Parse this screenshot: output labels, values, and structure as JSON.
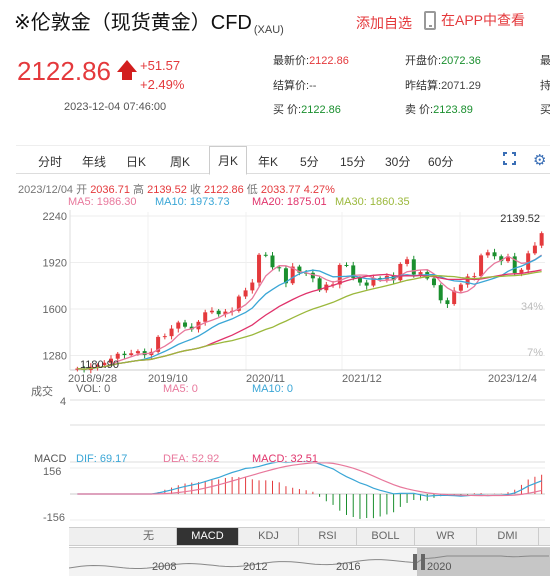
{
  "header": {
    "title": "※伦敦金（现货黄金）CFD",
    "title_sub": "(XAU)",
    "add_favorite": "添加自选",
    "app_link": "在APP中查看",
    "icons": [
      "phone-icon",
      "arrow-up-icon",
      "expand-icon",
      "gear-icon"
    ]
  },
  "quote": {
    "price": "2122.86",
    "change": "+51.57",
    "change_pct": "+2.49%",
    "timestamp": "2023-12-04 07:46:00",
    "stats": [
      {
        "label": "最新价:",
        "value": "2122.86",
        "color": "red"
      },
      {
        "label": "开盘价:",
        "value": "2072.36",
        "color": "green"
      },
      {
        "label": "最",
        "value": "",
        "color": "none"
      },
      {
        "label": "结算价:",
        "value": "--",
        "color": "none"
      },
      {
        "label": "昨结算:",
        "value": "2071.29",
        "color": "none"
      },
      {
        "label": "持",
        "value": "",
        "color": "none"
      },
      {
        "label": "买  价:",
        "value": "2122.86",
        "color": "green"
      },
      {
        "label": "卖  价:",
        "value": "2123.89",
        "color": "green"
      },
      {
        "label": "买",
        "value": "",
        "color": "none"
      }
    ]
  },
  "period_tabs": [
    "分时",
    "年线",
    "日K",
    "周K",
    "月K",
    "年K",
    "5分",
    "15分",
    "30分",
    "60分"
  ],
  "active_period": "月K",
  "info_line": {
    "date": "2023/12/04",
    "open_label": "开",
    "open": "2036.71",
    "high_label": "高",
    "high": "2139.52",
    "close_label": "收",
    "close": "2122.86",
    "low_label": "低",
    "low": "2033.77",
    "pct": "4.27%"
  },
  "ma": {
    "ma5": "MA5: 1986.30",
    "ma10": "MA10: 1973.73",
    "ma20": "MA20: 1875.01",
    "ma30": "MA30: 1860.35",
    "colors": {
      "ma5": "#e8789c",
      "ma10": "#3aa6d6",
      "ma20": "#e0336b",
      "ma30": "#9bb83c"
    }
  },
  "volume": {
    "label": "成交",
    "vol": "VOL: 0",
    "ma5": "MA5: 0",
    "ma10": "MA10: 0",
    "axis": "4"
  },
  "macd": {
    "label": "MACD",
    "dif": "DIF: 69.17",
    "dea": "DEA: 52.92",
    "macd": "MACD: 32.51",
    "axis_top": "156",
    "axis_bottom": "-156"
  },
  "indicator_tabs": [
    "无",
    "MACD",
    "KDJ",
    "RSI",
    "BOLL",
    "WR",
    "DMI"
  ],
  "active_indicator": "MACD",
  "nav_arrows": [
    "▲",
    "▼"
  ],
  "timeline_years": [
    "2008",
    "2012",
    "2016",
    "2020"
  ],
  "chart_data": {
    "type": "candlestick",
    "y_ticks": [
      "2240",
      "1920",
      "1600",
      "1280"
    ],
    "pct_ticks": [
      "34%",
      "7%"
    ],
    "x_ticks": [
      "2018/9/28",
      "2019/10",
      "2020/11",
      "2021/12",
      "2023/12/4"
    ],
    "max_label": "2139.52",
    "min_label": "1180.90",
    "ylim": [
      1180,
      2240
    ],
    "closes": [
      1190,
      1180,
      1203,
      1214,
      1230,
      1258,
      1292,
      1283,
      1295,
      1310,
      1283,
      1305,
      1408,
      1413,
      1465,
      1507,
      1478,
      1460,
      1512,
      1577,
      1588,
      1564,
      1582,
      1587,
      1686,
      1728,
      1782,
      1973,
      1968,
      1887,
      1880,
      1777,
      1892,
      1850,
      1849,
      1811,
      1729,
      1768,
      1769,
      1903,
      1900,
      1814,
      1782,
      1761,
      1813,
      1804,
      1828,
      1798,
      1910,
      1942,
      1837,
      1854,
      1810,
      1764,
      1660,
      1634,
      1726,
      1768,
      1824,
      1826,
      1969,
      1990,
      1963,
      1929,
      1962,
      1848,
      1870,
      1983,
      2036,
      2122
    ],
    "series": [
      {
        "name": "MA5",
        "color": "#e8789c"
      },
      {
        "name": "MA10",
        "color": "#3aa6d6"
      },
      {
        "name": "MA20",
        "color": "#e0336b"
      },
      {
        "name": "MA30",
        "color": "#9bb83c"
      }
    ]
  },
  "colors": {
    "up": "#e4393c",
    "down": "#1a8f2e",
    "accent": "#3b6fb6"
  }
}
